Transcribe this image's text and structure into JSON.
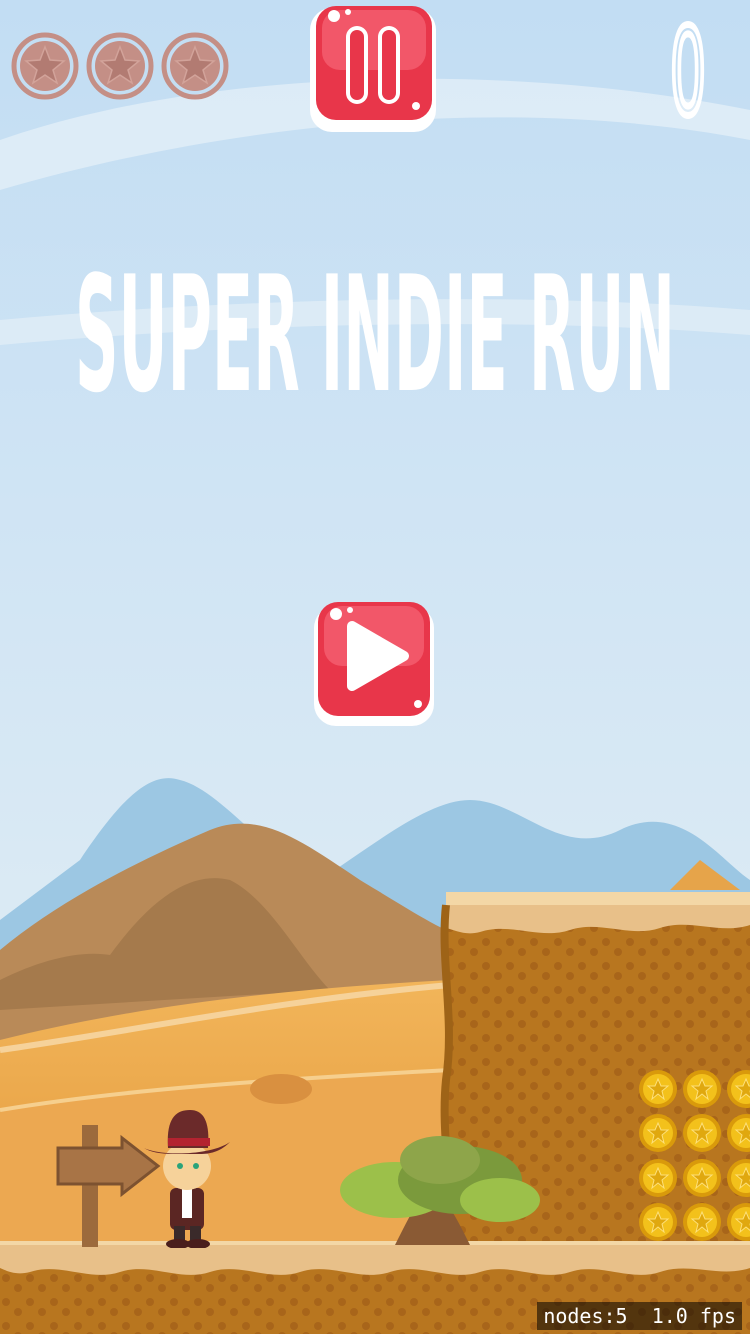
{
  "hud": {
    "lives": [
      {
        "icon": "sheriff-star-icon",
        "active": false
      },
      {
        "icon": "sheriff-star-icon",
        "active": false
      },
      {
        "icon": "sheriff-star-icon",
        "active": false
      }
    ],
    "pause_icon": "pause-icon",
    "score": "0"
  },
  "title": "SUPER INDIE RUN",
  "play_icon": "play-icon",
  "debug": {
    "nodes": "nodes:5",
    "fps": "1.0 fps"
  },
  "colors": {
    "sky_top": "#c2ddf3",
    "sky_bottom": "#e3eef5",
    "button_red": "#e8364a",
    "sand": "#e8c089",
    "dirt": "#b8761f",
    "coin": "#f3c11b",
    "life_inactive": "#c48f86"
  }
}
